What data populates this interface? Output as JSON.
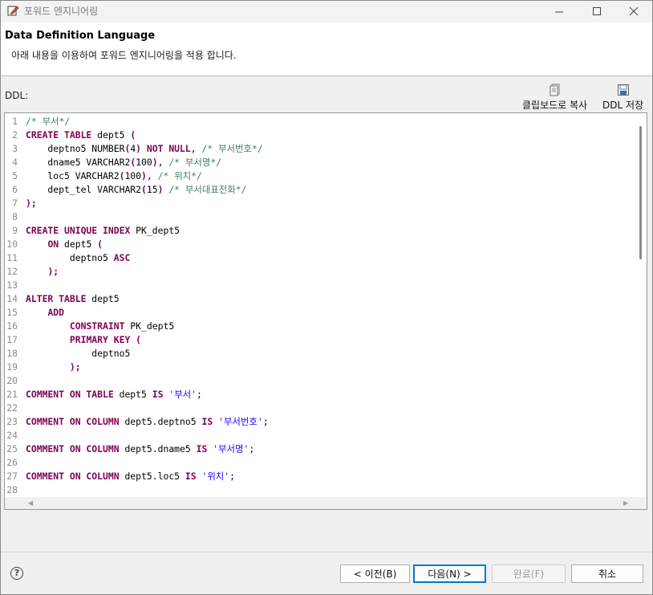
{
  "window": {
    "title": "포워드 엔지니어링"
  },
  "header": {
    "title": "Data Definition Language",
    "description": "아래 내용을 이용하여 포워드 엔지니어링을 적용 합니다."
  },
  "ddl_label": "DDL:",
  "toolbar": {
    "copy_label": "클립보드로 복사",
    "save_label": "DDL 저장"
  },
  "code_lines": [
    {
      "n": "1",
      "t": [
        {
          "c": "cm",
          "v": "/* "
        },
        {
          "c": "cm kr",
          "v": "부서"
        },
        {
          "c": "cm",
          "v": "*/"
        }
      ]
    },
    {
      "n": "2",
      "t": [
        {
          "c": "kw",
          "v": "CREATE TABLE"
        },
        {
          "c": "",
          "v": " dept5 "
        },
        {
          "c": "kw",
          "v": "("
        }
      ]
    },
    {
      "n": "3",
      "t": [
        {
          "c": "",
          "v": "    deptno5 NUMBER"
        },
        {
          "c": "kw",
          "v": "("
        },
        {
          "c": "",
          "v": "4"
        },
        {
          "c": "kw",
          "v": ")"
        },
        {
          "c": "",
          "v": " "
        },
        {
          "c": "kw",
          "v": "NOT NULL"
        },
        {
          "c": "",
          "v": ", "
        },
        {
          "c": "cm",
          "v": "/* "
        },
        {
          "c": "cm kr",
          "v": "부서번호"
        },
        {
          "c": "cm",
          "v": "*/"
        }
      ]
    },
    {
      "n": "4",
      "t": [
        {
          "c": "",
          "v": "    dname5 VARCHAR2"
        },
        {
          "c": "kw",
          "v": "("
        },
        {
          "c": "",
          "v": "100"
        },
        {
          "c": "kw",
          "v": ")"
        },
        {
          "c": "",
          "v": ", "
        },
        {
          "c": "cm",
          "v": "/* "
        },
        {
          "c": "cm kr",
          "v": "부서명"
        },
        {
          "c": "cm",
          "v": "*/"
        }
      ]
    },
    {
      "n": "5",
      "t": [
        {
          "c": "",
          "v": "    loc5 VARCHAR2"
        },
        {
          "c": "kw",
          "v": "("
        },
        {
          "c": "",
          "v": "100"
        },
        {
          "c": "kw",
          "v": ")"
        },
        {
          "c": "",
          "v": ", "
        },
        {
          "c": "cm",
          "v": "/* "
        },
        {
          "c": "cm kr",
          "v": "위치"
        },
        {
          "c": "cm",
          "v": "*/"
        }
      ]
    },
    {
      "n": "6",
      "t": [
        {
          "c": "",
          "v": "    dept_tel VARCHAR2"
        },
        {
          "c": "kw",
          "v": "("
        },
        {
          "c": "",
          "v": "15"
        },
        {
          "c": "kw",
          "v": ")"
        },
        {
          "c": "",
          "v": " "
        },
        {
          "c": "cm",
          "v": "/* "
        },
        {
          "c": "cm kr",
          "v": "부서대표전화"
        },
        {
          "c": "cm",
          "v": "*/"
        }
      ]
    },
    {
      "n": "7",
      "t": [
        {
          "c": "kw",
          "v": ");"
        }
      ]
    },
    {
      "n": "8",
      "t": []
    },
    {
      "n": "9",
      "t": [
        {
          "c": "kw",
          "v": "CREATE UNIQUE INDEX"
        },
        {
          "c": "",
          "v": " PK_dept5"
        }
      ]
    },
    {
      "n": "10",
      "t": [
        {
          "c": "",
          "v": "    "
        },
        {
          "c": "kw",
          "v": "ON"
        },
        {
          "c": "",
          "v": " dept5 "
        },
        {
          "c": "kw",
          "v": "("
        }
      ]
    },
    {
      "n": "11",
      "t": [
        {
          "c": "",
          "v": "        deptno5 "
        },
        {
          "c": "kw",
          "v": "ASC"
        }
      ]
    },
    {
      "n": "12",
      "t": [
        {
          "c": "",
          "v": "    "
        },
        {
          "c": "kw",
          "v": ");"
        }
      ]
    },
    {
      "n": "13",
      "t": []
    },
    {
      "n": "14",
      "t": [
        {
          "c": "kw",
          "v": "ALTER TABLE"
        },
        {
          "c": "",
          "v": " dept5"
        }
      ]
    },
    {
      "n": "15",
      "t": [
        {
          "c": "",
          "v": "    "
        },
        {
          "c": "kw",
          "v": "ADD"
        }
      ]
    },
    {
      "n": "16",
      "t": [
        {
          "c": "",
          "v": "        "
        },
        {
          "c": "kw",
          "v": "CONSTRAINT"
        },
        {
          "c": "",
          "v": " PK_dept5"
        }
      ]
    },
    {
      "n": "17",
      "t": [
        {
          "c": "",
          "v": "        "
        },
        {
          "c": "kw",
          "v": "PRIMARY KEY ("
        }
      ]
    },
    {
      "n": "18",
      "t": [
        {
          "c": "",
          "v": "            deptno5"
        }
      ]
    },
    {
      "n": "19",
      "t": [
        {
          "c": "",
          "v": "        "
        },
        {
          "c": "kw",
          "v": ");"
        }
      ]
    },
    {
      "n": "20",
      "t": []
    },
    {
      "n": "21",
      "t": [
        {
          "c": "kw",
          "v": "COMMENT ON TABLE"
        },
        {
          "c": "",
          "v": " dept5 "
        },
        {
          "c": "kw",
          "v": "IS"
        },
        {
          "c": "",
          "v": " "
        },
        {
          "c": "st",
          "v": "'"
        },
        {
          "c": "st kr",
          "v": "부서"
        },
        {
          "c": "st",
          "v": "'"
        },
        {
          "c": "",
          "v": ";"
        }
      ]
    },
    {
      "n": "22",
      "t": []
    },
    {
      "n": "23",
      "t": [
        {
          "c": "kw",
          "v": "COMMENT ON COLUMN"
        },
        {
          "c": "",
          "v": " dept5.deptno5 "
        },
        {
          "c": "kw",
          "v": "IS"
        },
        {
          "c": "",
          "v": " "
        },
        {
          "c": "st",
          "v": "'"
        },
        {
          "c": "st kr",
          "v": "부서번호"
        },
        {
          "c": "st",
          "v": "'"
        },
        {
          "c": "",
          "v": ";"
        }
      ]
    },
    {
      "n": "24",
      "t": []
    },
    {
      "n": "25",
      "t": [
        {
          "c": "kw",
          "v": "COMMENT ON COLUMN"
        },
        {
          "c": "",
          "v": " dept5.dname5 "
        },
        {
          "c": "kw",
          "v": "IS"
        },
        {
          "c": "",
          "v": " "
        },
        {
          "c": "st",
          "v": "'"
        },
        {
          "c": "st kr",
          "v": "부서명"
        },
        {
          "c": "st",
          "v": "'"
        },
        {
          "c": "",
          "v": ";"
        }
      ]
    },
    {
      "n": "26",
      "t": []
    },
    {
      "n": "27",
      "t": [
        {
          "c": "kw",
          "v": "COMMENT ON COLUMN"
        },
        {
          "c": "",
          "v": " dept5.loc5 "
        },
        {
          "c": "kw",
          "v": "IS"
        },
        {
          "c": "",
          "v": " "
        },
        {
          "c": "st",
          "v": "'"
        },
        {
          "c": "st kr",
          "v": "위치"
        },
        {
          "c": "st",
          "v": "'"
        },
        {
          "c": "",
          "v": ";"
        }
      ]
    },
    {
      "n": "28",
      "t": []
    }
  ],
  "buttons": {
    "back": "< 이전(B)",
    "next": "다음(N) >",
    "finish": "완료(F)",
    "cancel": "취소"
  },
  "colors": {
    "keyword": "#7f0055",
    "comment": "#3f7f5f",
    "string": "#2a00ff",
    "accent": "#0078d7"
  }
}
